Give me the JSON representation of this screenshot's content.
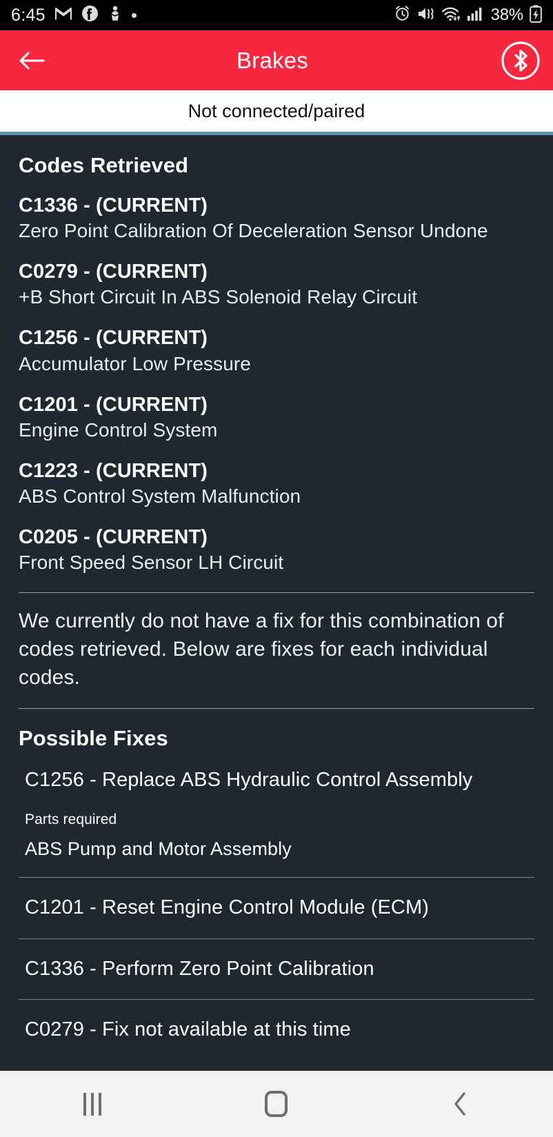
{
  "status_bar": {
    "time": "6:45",
    "left_icons": [
      "gmail-icon",
      "facebook-icon",
      "app-icon",
      "dot-indicator"
    ],
    "right_icons": [
      "alarm-icon",
      "vibrate-mute-icon",
      "wifi-icon",
      "cellular-signal-icon"
    ],
    "battery_percent": "38%",
    "battery_state": "charging"
  },
  "app_bar": {
    "back_label": "back-arrow",
    "title": "Brakes",
    "bluetooth_label": "bluetooth-toggle",
    "background_color": "#f72740"
  },
  "connection": {
    "status_text": "Not connected/paired",
    "accent_color": "#5c93b8"
  },
  "codes_section": {
    "heading": "Codes Retrieved",
    "codes": [
      {
        "code": "C1336 - (CURRENT)",
        "description": "Zero Point Calibration Of Deceleration Sensor Undone"
      },
      {
        "code": "C0279 - (CURRENT)",
        "description": "+B Short Circuit In ABS Solenoid Relay Circuit"
      },
      {
        "code": "C1256 - (CURRENT)",
        "description": "Accumulator Low Pressure"
      },
      {
        "code": "C1201 - (CURRENT)",
        "description": "Engine Control System"
      },
      {
        "code": "C1223 - (CURRENT)",
        "description": "ABS Control System Malfunction"
      },
      {
        "code": "C0205 - (CURRENT)",
        "description": "Front Speed Sensor LH Circuit"
      }
    ]
  },
  "note": "We currently do not have a fix for this combination of codes retrieved. Below are fixes for each individual codes.",
  "fixes_section": {
    "heading": "Possible Fixes",
    "fixes": [
      {
        "title": "C1256 - Replace ABS Hydraulic Control Assembly",
        "parts_label": "Parts required",
        "parts_value": "ABS Pump and Motor Assembly"
      },
      {
        "title": "C1201 - Reset Engine Control Module (ECM)"
      },
      {
        "title": "C1336 - Perform Zero Point Calibration"
      },
      {
        "title": "C0279 - Fix not available at this time"
      }
    ]
  },
  "nav_bar": {
    "recents_label": "recents-button",
    "home_label": "home-button",
    "back_label": "back-button"
  },
  "colors": {
    "content_background": "#1f2730",
    "app_bar": "#f72740",
    "accent_line": "#5c93b8",
    "nav_background": "#f2f2f2"
  }
}
